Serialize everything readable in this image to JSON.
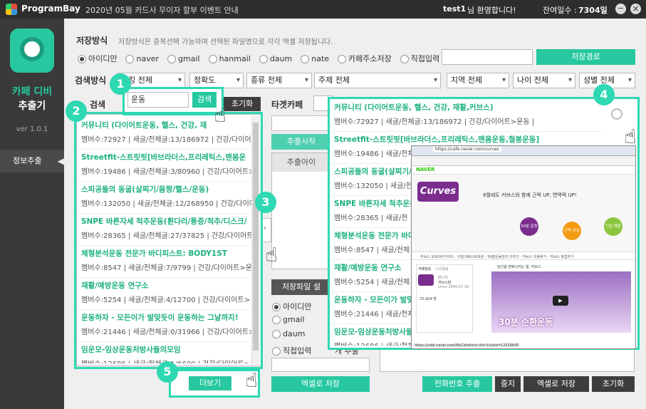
{
  "titlebar": {
    "logo": "ProgramBay",
    "notice": "2020년 05월 카드사 무이자 할부 이벤트 안내",
    "user": "test1",
    "greeting": "님 환영합니다!",
    "remain_label": "잔여일수 :",
    "remain_value": "7304일",
    "minimize": "−",
    "close": "×"
  },
  "sidebar": {
    "app_name_1": "카페 디비",
    "app_name_2": "추출기",
    "version": "ver 1.0.1",
    "menu": "정보추출"
  },
  "save": {
    "label": "저장방식",
    "desc": "저장방식은 중복선택 가능하며 선택된 파일명으로 각각 엑셀 저장됩니다.",
    "options": [
      "아이디만",
      "naver",
      "gmail",
      "hanmail",
      "daum",
      "nate",
      "카페주소저장",
      "직접입력"
    ],
    "path_button": "저장경로"
  },
  "search": {
    "label": "검색방식",
    "label_short": "방식",
    "filters": [
      "랭킹 전체",
      "정확도",
      "종류 전체",
      "주제 전체",
      "지역 전체",
      "나이 전체",
      "성별 전체"
    ],
    "keyword_label": "검색",
    "keyword": "운동",
    "search_button": "검색",
    "reset_button": "초기화"
  },
  "results_left": [
    {
      "t": "커뮤니티 (다이어트운동, 헬스, 건강, 재",
      "s": "멤버수:72927 | 새글/전체글:13/186972 | 건강/다이어트"
    },
    {
      "t": "Streetfit-스트릿핏[바브라더스,프리레틱스,맨몸운",
      "s": "멤버수:19486 | 새글/전체글:3/80960 | 건강/다이어트>"
    },
    {
      "t": "스피공들의 동굴(살찌기/몸짱/헬스/운동)",
      "s": "멤버수:132050 | 새글/전체글:12/268950 | 건강/다이어트"
    },
    {
      "t": "SNPE 바른자세 척추운동(휜다리/통증/척추/디스크/",
      "s": "멤버수:28365 | 새글/전체글:27/37825 | 건강/다이어트>"
    },
    {
      "t": "체형분석운동 전문가 바디피스트: BODY1ST",
      "s": "멤버수:8547 | 새글/전체글:7/9799 | 건강/다이어트>운"
    },
    {
      "t": "재활/예방운동 연구소",
      "s": "멤버수:5254 | 새글/전체글:4/12700 | 건강/다이어트>"
    },
    {
      "t": "운동하자 - 모든이가 발맞듯이 운동하는 그날까지!",
      "s": "멤버수:21446 | 새글/전체글:0/31966 | 건강/다이어트>"
    },
    {
      "t": "임운모-임상운동처방사들의모임",
      "s": "멤버수:12686 | 새글/전체글:1/6600 | 건강/다이어트>운"
    }
  ],
  "more_button": "더보기",
  "middle": {
    "target_label": "타겟카페",
    "extract_start": "추출시작",
    "extract_id": "추출아이",
    "file_label": "저장파일 설",
    "radios": [
      "아이디만",
      "gmail",
      "daum",
      "직접입력"
    ],
    "radio_right": "개 추출",
    "excel_button": "엑셀로 저장"
  },
  "popup": [
    {
      "t": "커뮤니티 (다이어트운동, 헬스, 건강, 재활,커브스)",
      "s": "멤버수:72927 | 새글/전체글:13/186972 | 건강/다이어트>운동 |"
    },
    {
      "t": "Streetfit-스트릿핏[바브라더스,프리레틱스,맨몸운동,철봉운동]",
      "s": "멤버수:19486 | 새글/전체글"
    },
    {
      "t": "스피공들의 동굴(살찌기/",
      "s": "멤버수:132050 | 새글/전"
    },
    {
      "t": "SNPE 바른자세 척추운동",
      "s": "멤버수:28365 | 새글/전"
    },
    {
      "t": "체형분석운동 전문가 바디",
      "s": "멤버수:8547 | 새글/전체"
    },
    {
      "t": "재활/예방운동 연구소",
      "s": "멤버수:5254 | 새글/전체"
    },
    {
      "t": "운동하자 - 모든이가 발맞",
      "s": "멤버수:21446 | 새글/전체"
    },
    {
      "t": "임운모-임상운동처방사들",
      "s": "멤버수:12686 | 새글/전체"
    }
  ],
  "browser": {
    "url": "https://cafe.naver.com/curves",
    "site": "NAVER",
    "logo": "Curves",
    "slogan": "8월에도 커브스와 함께 근력 UP, 면역력 UP!",
    "steps": [
      "30분 운동",
      "근력 상승",
      "건강 체중"
    ],
    "nav": "커브스 오버라이가이드 · 이달의베스트회원 · 30분운동만의 이야기 · 커브스 이용후기 · 커브스 창업하기",
    "video_title": "30분 순환운동",
    "cafe_name": "커브스 커뮤니티",
    "tab_info": "카페정보",
    "tab_activity": "나의활동",
    "manager": "매니저",
    "manager_name": "커브스맘",
    "members_count": "72,924 명",
    "since": "since 2006.07.19",
    "status": "https://cafe.naver.com/MyCafeIntro.nhn?clubid=12516645",
    "video_banner": "당신을 변화시키는 힘, 커브스"
  },
  "bottom": {
    "phone_button": "전화번호 추출",
    "stop_button": "중지",
    "excel_button": "엑셀로 저장",
    "reset_button": "초기화"
  },
  "badges": [
    "1",
    "2",
    "3",
    "4",
    "5"
  ],
  "icons": {
    "hand": "pointing-hand-icon",
    "search": "search-icon",
    "arrow": "chevron-right-icon"
  },
  "colors": {
    "accent": "#27c8a0",
    "highlight": "#2dd8b2",
    "title_bg": "#2e2e2e"
  }
}
